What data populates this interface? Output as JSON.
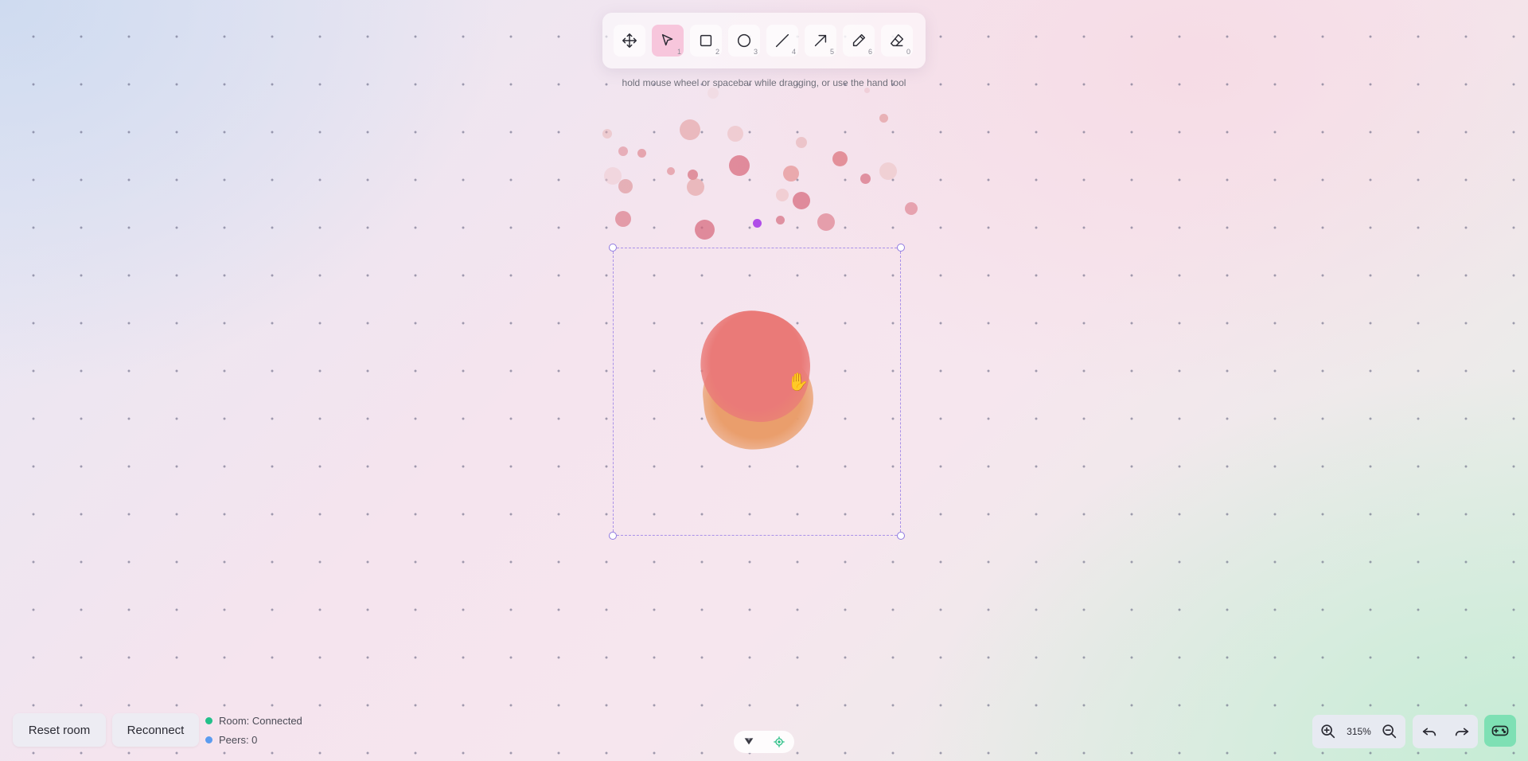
{
  "toolbar": {
    "tools": [
      {
        "name": "move",
        "icon": "move-icon",
        "shortcut": ""
      },
      {
        "name": "select",
        "icon": "pointer-icon",
        "shortcut": "1",
        "active": true
      },
      {
        "name": "rectangle",
        "icon": "square-icon",
        "shortcut": "2"
      },
      {
        "name": "ellipse",
        "icon": "circle-icon",
        "shortcut": "3"
      },
      {
        "name": "line",
        "icon": "line-icon",
        "shortcut": "4"
      },
      {
        "name": "arrow",
        "icon": "arrow-icon",
        "shortcut": "5"
      },
      {
        "name": "pencil",
        "icon": "pencil-icon",
        "shortcut": "6"
      },
      {
        "name": "eraser",
        "icon": "eraser-icon",
        "shortcut": "0"
      }
    ],
    "hint": "hold mouse wheel or spacebar while dragging, or use the hand tool"
  },
  "buttons": {
    "reset_room": "Reset room",
    "reconnect": "Reconnect"
  },
  "status": {
    "room": "Room: Connected",
    "peers": "Peers: 0",
    "room_color": "#22c08a",
    "peers_color": "#5b9cf0"
  },
  "zoom": {
    "value": "315%"
  },
  "colors": {
    "accent_active_tool": "#f7c6dc",
    "selection": "#a991e8",
    "blob_red": "#ea7a78",
    "blob_orange": "#ea9e6c",
    "gamepad_button": "#7ee0b4"
  }
}
